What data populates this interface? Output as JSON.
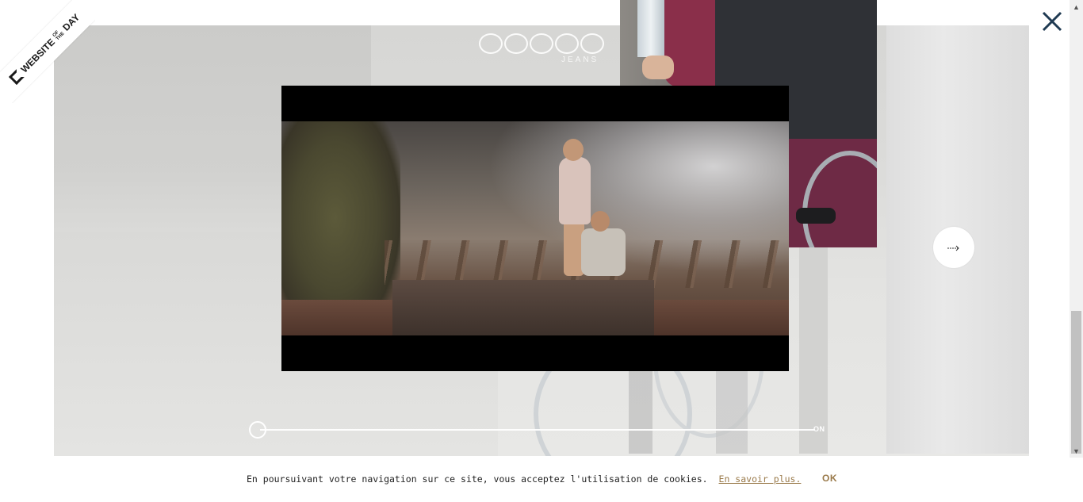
{
  "badge": {
    "website": "WEBSITE",
    "of": "OF",
    "the": "THE",
    "day": "DAY"
  },
  "hero": {
    "logo_sub": "JEANS"
  },
  "player": {
    "toggle_label": "ON",
    "progress": 0.0
  },
  "icons": {
    "close": "close-icon",
    "next": "arrow-right-icon",
    "scroll_up": "chevron-up-icon",
    "scroll_down": "chevron-down-icon"
  },
  "cookie": {
    "text": "En poursuivant votre navigation sur ce site, vous acceptez l'utilisation de cookies.",
    "link": "En savoir plus.",
    "ok": "OK"
  },
  "colors": {
    "accent": "#9a7a4a",
    "close": "#1f3a52",
    "video_bg": "#000000"
  }
}
